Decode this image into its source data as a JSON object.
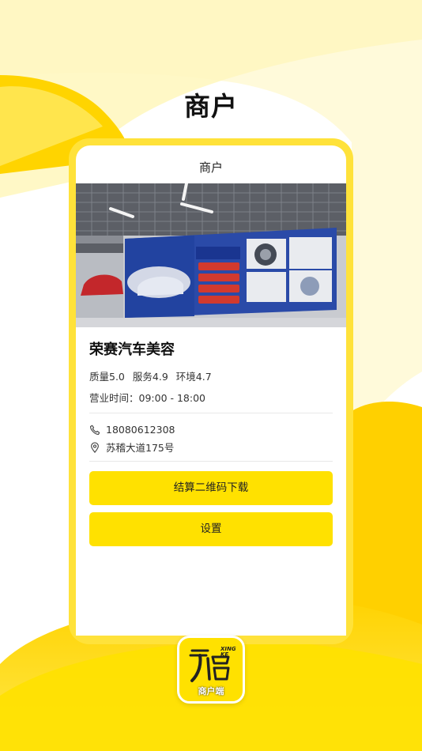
{
  "page": {
    "title": "商户"
  },
  "screen": {
    "nav_title": "商户",
    "store": {
      "name": "荣赛汽车美容",
      "ratings": {
        "quality": "质量5.0",
        "service": "服务4.9",
        "environment": "环境4.7"
      },
      "hours": "营业时间：09:00 - 18:00",
      "phone": "18080612308",
      "address": "苏稽大道175号"
    },
    "buttons": {
      "qr_download": "结算二维码下载",
      "settings": "设置"
    }
  },
  "logo": {
    "caption": "商户端",
    "brand_text": "XING KE"
  },
  "colors": {
    "accent": "#ffe100",
    "frame": "#ffe23a",
    "banner": "#2a4aa8"
  },
  "icons": [
    "phone-icon",
    "location-pin-icon"
  ]
}
